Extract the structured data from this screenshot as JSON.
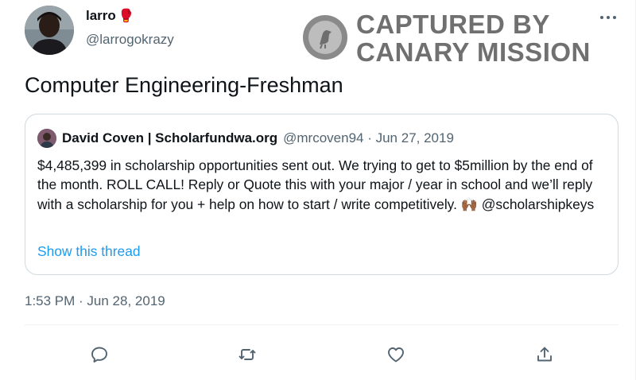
{
  "author": {
    "name": "larro",
    "name_emoji": "🥊",
    "handle": "@larrogokrazy"
  },
  "watermark": {
    "line1": "CAPTURED BY",
    "line2": "CANARY MISSION"
  },
  "tweet": {
    "text": "Computer Engineering-Freshman",
    "timestamp": "1:53 PM · Jun 28, 2019"
  },
  "quoted": {
    "name": "David Coven | Scholarfundwa.org",
    "meta": "@mrcoven94 · Jun 27, 2019",
    "body": "$4,485,399 in scholarship opportunities sent out. We trying to get to $5million by the end of the month. ROLL CALL! Reply or Quote this with your major / year in school and we’ll reply with a scholarship for you + help on how to start / write competitively.",
    "body_emoji": "🙌🏾",
    "mention": "@scholarshipkeys",
    "show_thread": "Show this thread"
  },
  "actions": {
    "reply_icon": "reply-icon",
    "retweet_icon": "retweet-icon",
    "like_icon": "like-icon",
    "share_icon": "share-icon"
  },
  "colors": {
    "link": "#1d9bf0",
    "secondary_text": "#536471",
    "border": "#cfd9de",
    "watermark": "#707070"
  }
}
